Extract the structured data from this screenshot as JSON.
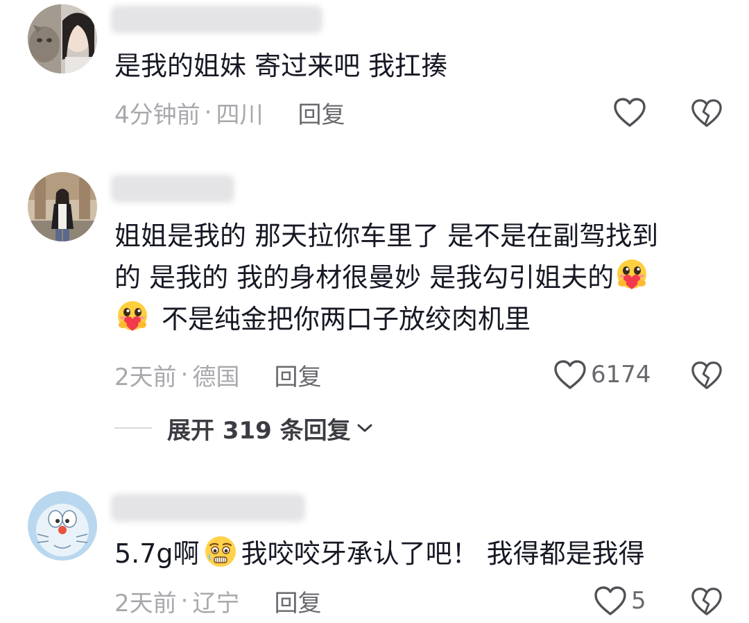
{
  "comments": [
    {
      "text_lines": [
        "是我的姐妹 寄过来吧 我扛揍"
      ],
      "time": "4分钟前",
      "separator": "·",
      "location": "四川",
      "reply_label": "回复",
      "likes": ""
    },
    {
      "text_lines": [
        "姐姐是我的 那天拉你车里了 是不是在副驾找到",
        "的 是我的 我的身材很曼妙 是我勾引姐夫的",
        "不是纯金把你两口子放绞肉机里"
      ],
      "time": "2天前",
      "separator": "·",
      "location": "德国",
      "reply_label": "回复",
      "likes": "6174",
      "expand_label": "展开 319 条回复"
    },
    {
      "text_pre": "5.7g啊",
      "text_post": "我咬咬牙承认了吧！ 我得都是我得",
      "time": "2天前",
      "separator": "·",
      "location": "辽宁",
      "reply_label": "回复",
      "likes": "5"
    }
  ],
  "icons": {
    "like": "heart-outline-icon",
    "dislike": "broken-heart-icon",
    "expand": "chevron-down-icon",
    "emoji_love": "hugging-heart-emoji",
    "emoji_plead": "pleading-face-emoji"
  },
  "colors": {
    "text": "#161823",
    "meta": "#a8a8ad",
    "reply": "#68686e",
    "blur": "#e4e4e6"
  }
}
